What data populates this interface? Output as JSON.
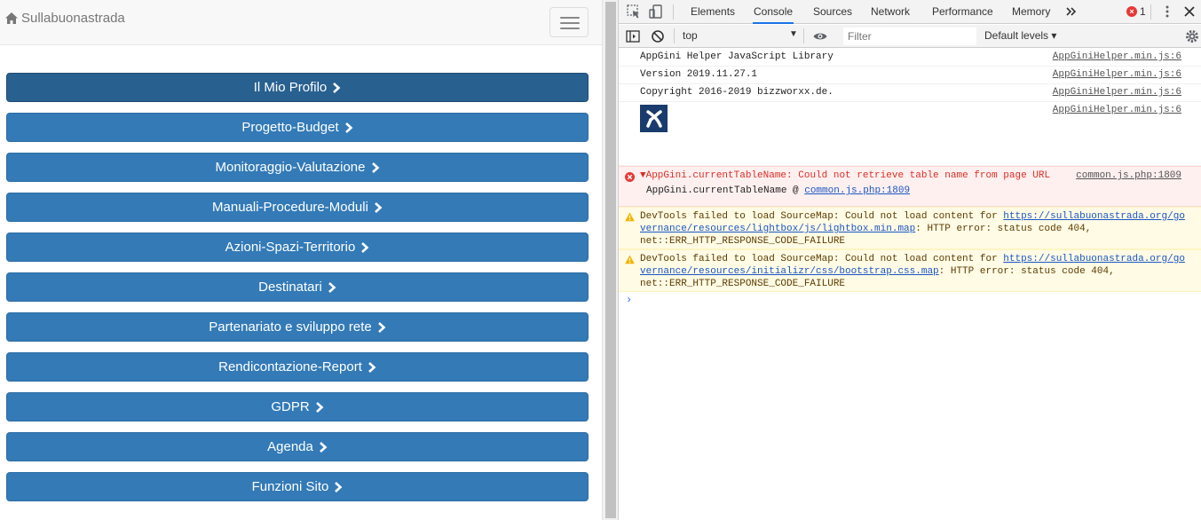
{
  "page": {
    "brand": "Sullabuonastrada",
    "menu": [
      "Il Mio Profilo",
      "Progetto-Budget",
      "Monitoraggio-Valutazione",
      "Manuali-Procedure-Moduli",
      "Azioni-Spazi-Territorio",
      "Destinatari",
      "Partenariato e sviluppo rete",
      "Rendicontazione-Report",
      "GDPR",
      "Agenda",
      "Funzioni Sito"
    ]
  },
  "devtools": {
    "tabs": [
      "Elements",
      "Console",
      "Sources",
      "Network",
      "Performance",
      "Memory"
    ],
    "active_tab": "Console",
    "error_count": "1",
    "context": "top",
    "filter_placeholder": "Filter",
    "levels": "Default levels",
    "messages": {
      "m1": {
        "text": "AppGini Helper JavaScript Library",
        "source": "AppGiniHelper.min.js:6"
      },
      "m2": {
        "text": "Version 2019.11.27.1",
        "source": "AppGiniHelper.min.js:6"
      },
      "m3": {
        "text": "Copyright 2016-2019 bizzworxx.de.",
        "source": "AppGiniHelper.min.js:6"
      },
      "m4": {
        "source": "AppGiniHelper.min.js:6"
      },
      "err": {
        "text": "AppGini.currentTableName: Could not retrieve table name from page URL",
        "source": "common.js.php:1809",
        "sub_prefix": "AppGini.currentTableName @ ",
        "sub_link": "common.js.php:1809"
      },
      "w1": {
        "line1_prefix": "DevTools failed to load SourceMap: Could not load content for ",
        "line1_link": "https://sullabuonastrada.org/go",
        "line2_link": "vernance/resources/lightbox/js/lightbox.min.map",
        "line2_suffix": ": HTTP error: status code 404,",
        "line3": "net::ERR_HTTP_RESPONSE_CODE_FAILURE"
      },
      "w2": {
        "line1_prefix": "DevTools failed to load SourceMap: Could not load content for ",
        "line1_link": "https://sullabuonastrada.org/go",
        "line2_link": "vernance/resources/initializr/css/bootstrap.css.map",
        "line2_suffix": ": HTTP error: status code 404,",
        "line3": "net::ERR_HTTP_RESPONSE_CODE_FAILURE"
      }
    }
  }
}
